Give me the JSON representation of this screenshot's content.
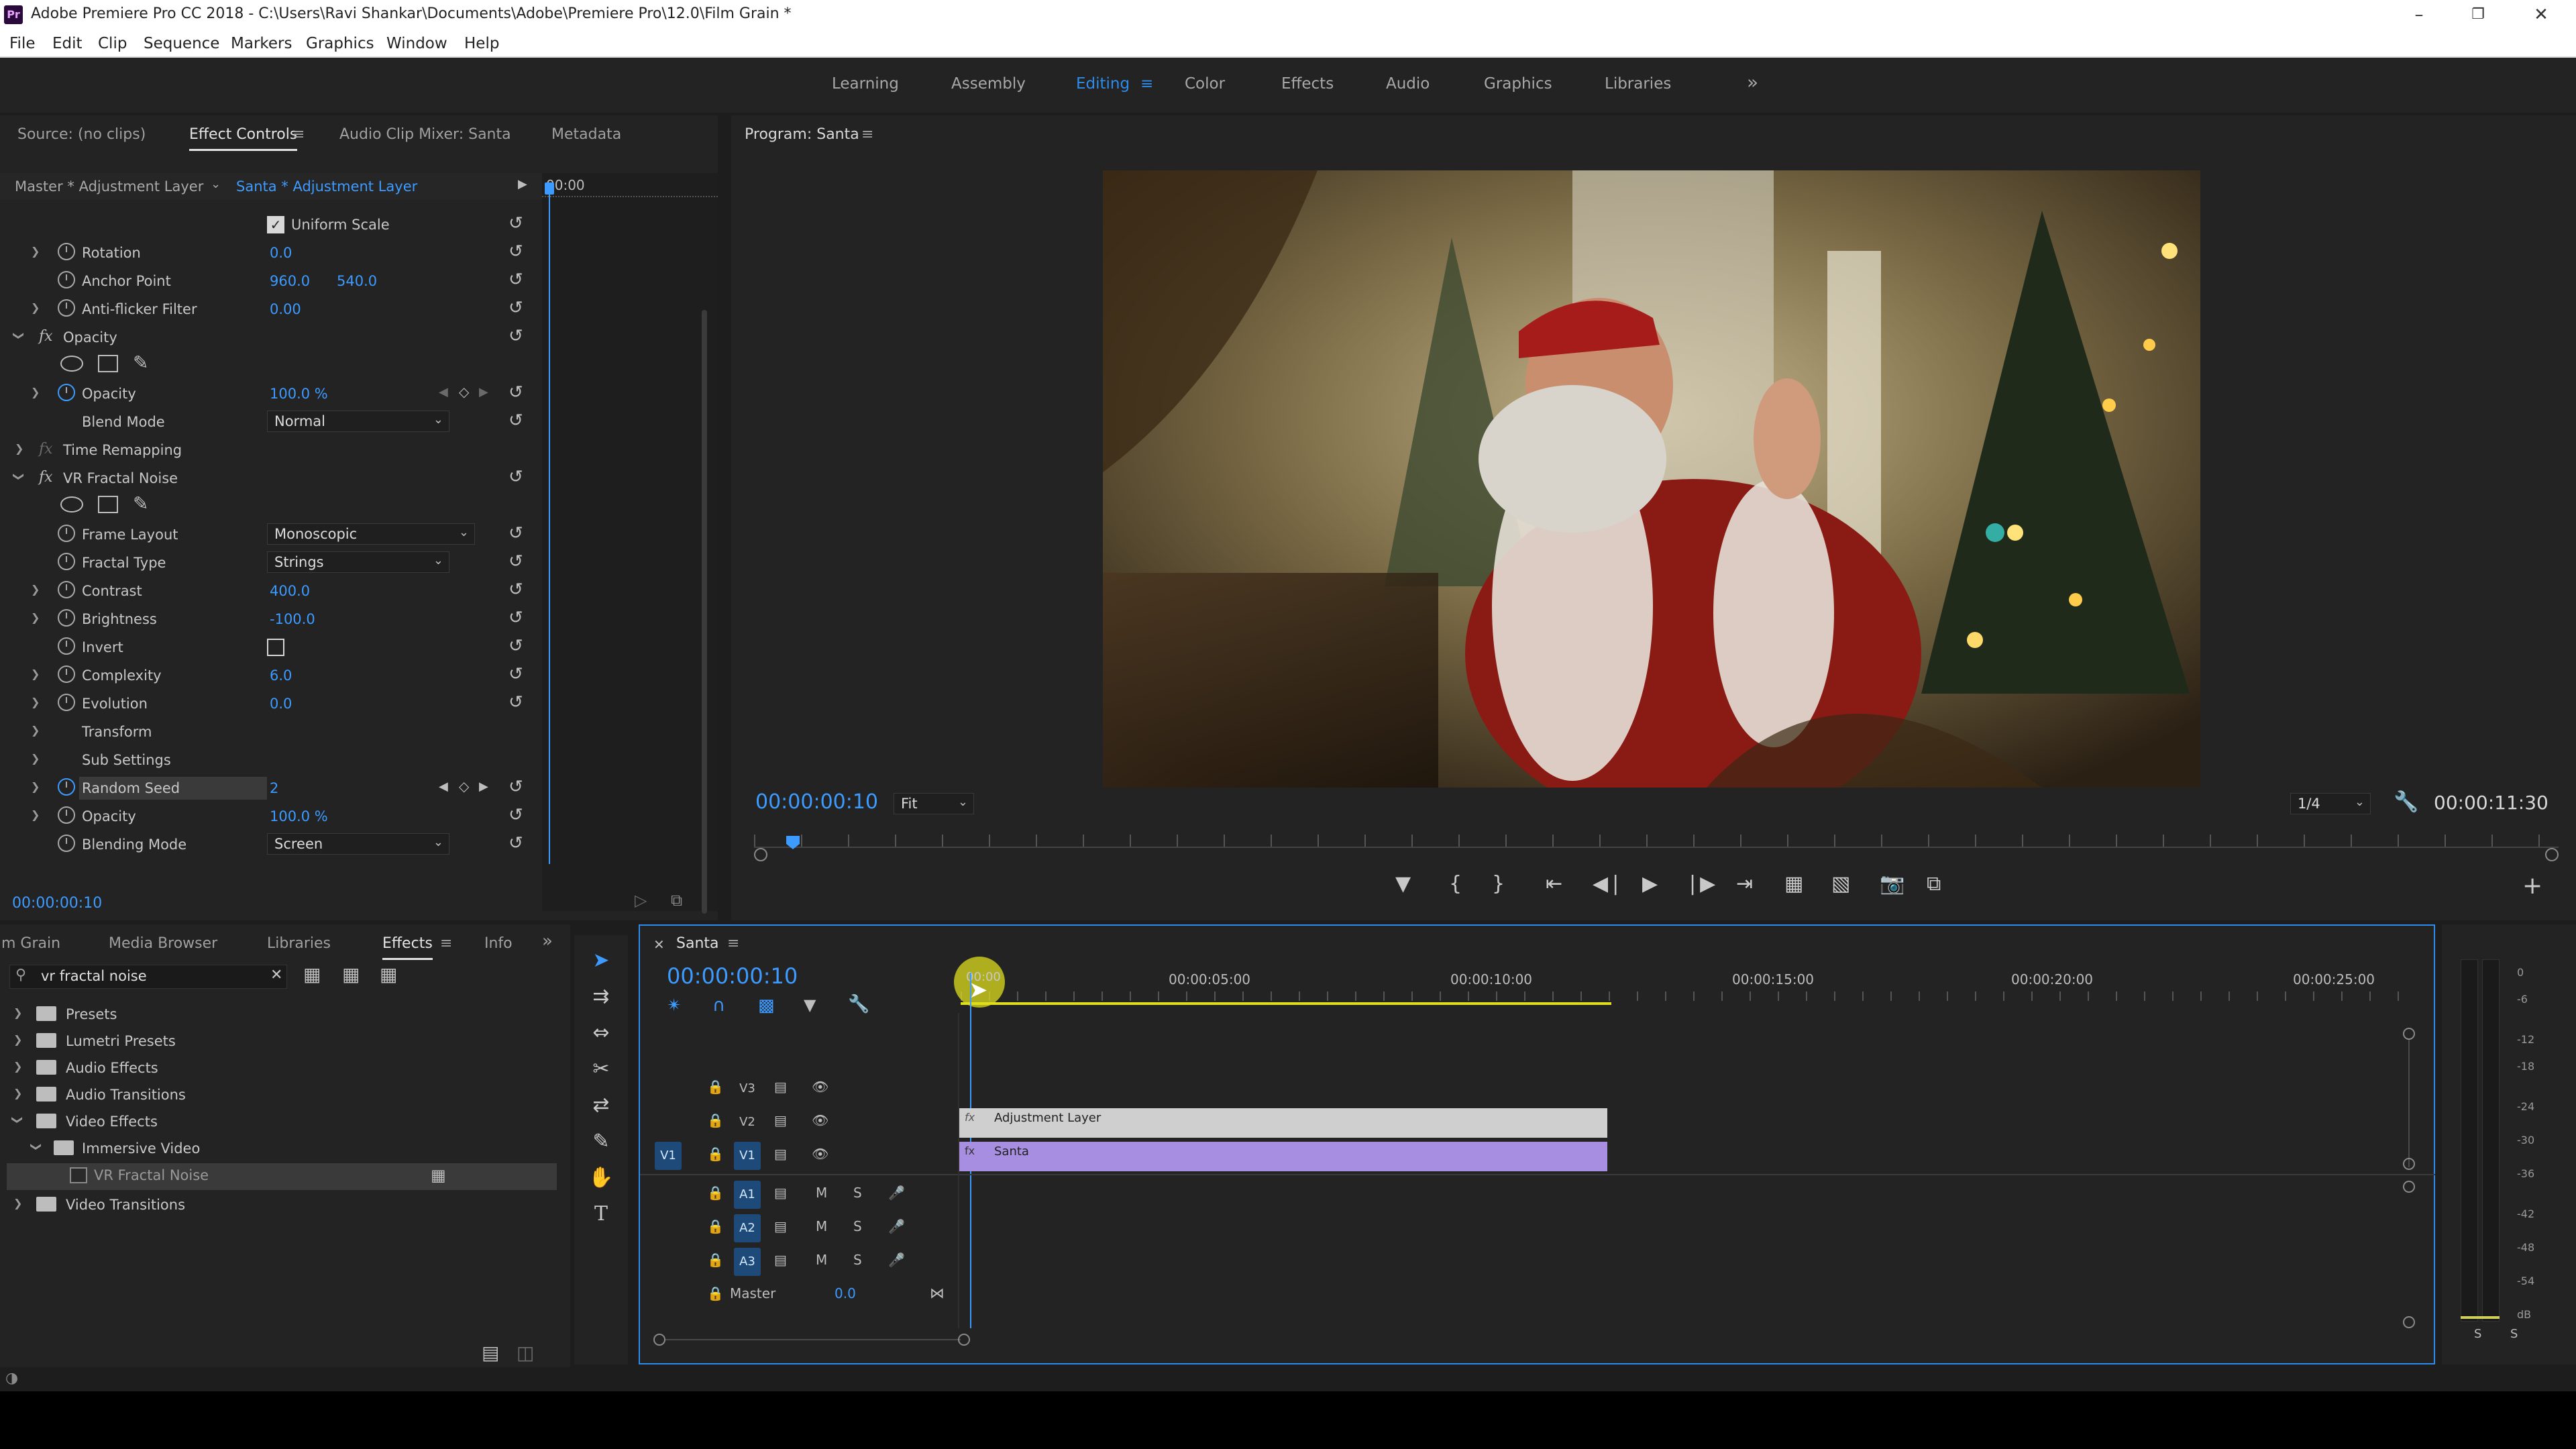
{
  "window": {
    "title": "Adobe Premiere Pro CC 2018 - C:\\Users\\Ravi Shankar\\Documents\\Adobe\\Premiere Pro\\12.0\\Film Grain *",
    "app_icon": "Pr"
  },
  "menu": [
    "File",
    "Edit",
    "Clip",
    "Sequence",
    "Markers",
    "Graphics",
    "Window",
    "Help"
  ],
  "workspaces": {
    "tabs": [
      "Learning",
      "Assembly",
      "Editing",
      "Color",
      "Effects",
      "Audio",
      "Graphics",
      "Libraries"
    ],
    "active": "Editing",
    "more": "»"
  },
  "source_panel": {
    "tabs": [
      "Source: (no clips)",
      "Effect Controls",
      "Audio Clip Mixer: Santa",
      "Metadata"
    ],
    "active_tab": "Effect Controls",
    "master_label": "Master * Adjustment Layer",
    "clip_label": "Santa * Adjustment Layer",
    "ruler_time": "00:00",
    "timecode": "00:00:00:10"
  },
  "effect_controls": {
    "uniform_scale": "Uniform Scale",
    "rotation": {
      "label": "Rotation",
      "value": "0.0"
    },
    "anchor_point": {
      "label": "Anchor Point",
      "x": "960.0",
      "y": "540.0"
    },
    "anti_flicker": {
      "label": "Anti-flicker Filter",
      "value": "0.00"
    },
    "opacity_group": "Opacity",
    "opacity": {
      "label": "Opacity",
      "value": "100.0 %"
    },
    "blend_mode": {
      "label": "Blend Mode",
      "value": "Normal"
    },
    "time_remapping": "Time Remapping",
    "vr_fractal_noise": "VR Fractal Noise",
    "frame_layout": {
      "label": "Frame Layout",
      "value": "Monoscopic"
    },
    "fractal_type": {
      "label": "Fractal Type",
      "value": "Strings"
    },
    "contrast": {
      "label": "Contrast",
      "value": "400.0"
    },
    "brightness": {
      "label": "Brightness",
      "value": "-100.0"
    },
    "invert": {
      "label": "Invert"
    },
    "complexity": {
      "label": "Complexity",
      "value": "6.0"
    },
    "evolution": {
      "label": "Evolution",
      "value": "0.0"
    },
    "transform": "Transform",
    "sub_settings": "Sub Settings",
    "random_seed": {
      "label": "Random Seed",
      "value": "2"
    },
    "opacity2": {
      "label": "Opacity",
      "value": "100.0 %"
    },
    "blending_mode": {
      "label": "Blending Mode",
      "value": "Screen"
    }
  },
  "program_monitor": {
    "title": "Program: Santa",
    "timecode": "00:00:00:10",
    "fit": "Fit",
    "resolution": "1/4",
    "duration": "00:00:11:30"
  },
  "effects_panel": {
    "tabs": [
      "m Grain",
      "Media Browser",
      "Libraries",
      "Effects",
      "Info"
    ],
    "active_tab": "Effects",
    "search_value": "vr fractal noise",
    "tree": [
      {
        "label": "Presets"
      },
      {
        "label": "Lumetri Presets"
      },
      {
        "label": "Audio Effects"
      },
      {
        "label": "Audio Transitions"
      },
      {
        "label": "Video Effects"
      },
      {
        "label": "Immersive Video"
      },
      {
        "label": "VR Fractal Noise"
      },
      {
        "label": "Video Transitions"
      }
    ]
  },
  "timeline": {
    "sequence_name": "Santa",
    "timecode": "00:00:00:10",
    "ruler": [
      "00:00:05:00",
      "00:00:10:00",
      "00:00:15:00",
      "00:00:20:00",
      "00:00:25:00"
    ],
    "playhead_label": "00:00",
    "video_tracks": [
      "V3",
      "V2",
      "V1"
    ],
    "audio_tracks": [
      "A1",
      "A2",
      "A3"
    ],
    "source_patch_v": "V1",
    "master_label": "Master",
    "master_value": "0.0",
    "clips": {
      "adjustment": "Adjustment Layer",
      "santa": "Santa"
    },
    "track_buttons": {
      "mute": "M",
      "solo": "S"
    }
  },
  "meter": {
    "labels": [
      "0",
      "-6",
      "-12",
      "-18",
      "-24",
      "-30",
      "-36",
      "-42",
      "-48",
      "-54",
      "dB"
    ],
    "solo_buttons": [
      "S",
      "S"
    ]
  },
  "colors": {
    "accent_blue": "#2d8ceb",
    "adjustment_clip": "#c9c9c9",
    "santa_clip": "#a88ee0",
    "playhead_yellow": "#dede1f"
  }
}
